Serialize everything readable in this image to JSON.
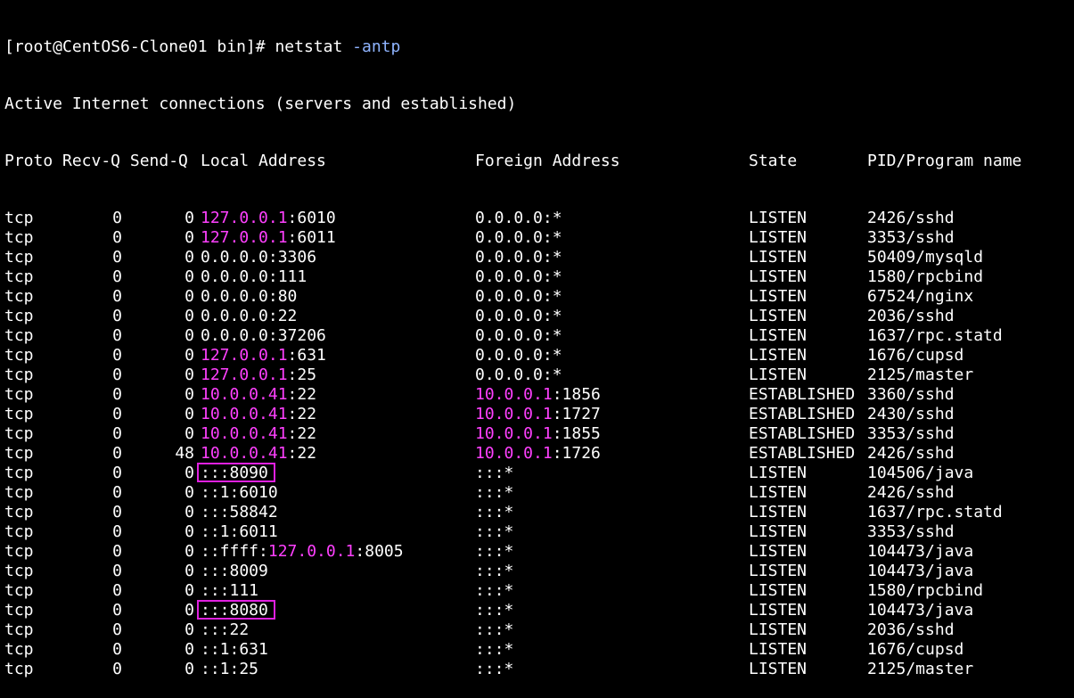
{
  "prompt": {
    "text": "[root@CentOS6-Clone01 bin]# ",
    "command": "netstat",
    "option": "-antp"
  },
  "header_line": "Active Internet connections (servers and established)",
  "columns": {
    "proto": "Proto",
    "recv_send": "Recv-Q Send-Q",
    "local": "Local Address",
    "foreign": "Foreign Address",
    "state": "State",
    "pid": "PID/Program name"
  },
  "highlight_color": "#e020e0",
  "ip_color": "#ff40ff",
  "rows": [
    {
      "proto": "tcp",
      "recv": "0",
      "send": "0",
      "local": [
        {
          "t": "127.0.0.1",
          "ip": true
        },
        {
          "t": ":6010"
        }
      ],
      "foreign": [
        {
          "t": "0.0.0.0:*"
        }
      ],
      "state": "LISTEN",
      "pid": "2426/sshd"
    },
    {
      "proto": "tcp",
      "recv": "0",
      "send": "0",
      "local": [
        {
          "t": "127.0.0.1",
          "ip": true
        },
        {
          "t": ":6011"
        }
      ],
      "foreign": [
        {
          "t": "0.0.0.0:*"
        }
      ],
      "state": "LISTEN",
      "pid": "3353/sshd"
    },
    {
      "proto": "tcp",
      "recv": "0",
      "send": "0",
      "local": [
        {
          "t": "0.0.0.0:3306"
        }
      ],
      "foreign": [
        {
          "t": "0.0.0.0:*"
        }
      ],
      "state": "LISTEN",
      "pid": "50409/mysqld"
    },
    {
      "proto": "tcp",
      "recv": "0",
      "send": "0",
      "local": [
        {
          "t": "0.0.0.0:111"
        }
      ],
      "foreign": [
        {
          "t": "0.0.0.0:*"
        }
      ],
      "state": "LISTEN",
      "pid": "1580/rpcbind"
    },
    {
      "proto": "tcp",
      "recv": "0",
      "send": "0",
      "local": [
        {
          "t": "0.0.0.0:80"
        }
      ],
      "foreign": [
        {
          "t": "0.0.0.0:*"
        }
      ],
      "state": "LISTEN",
      "pid": "67524/nginx"
    },
    {
      "proto": "tcp",
      "recv": "0",
      "send": "0",
      "local": [
        {
          "t": "0.0.0.0:22"
        }
      ],
      "foreign": [
        {
          "t": "0.0.0.0:*"
        }
      ],
      "state": "LISTEN",
      "pid": "2036/sshd"
    },
    {
      "proto": "tcp",
      "recv": "0",
      "send": "0",
      "local": [
        {
          "t": "0.0.0.0:37206"
        }
      ],
      "foreign": [
        {
          "t": "0.0.0.0:*"
        }
      ],
      "state": "LISTEN",
      "pid": "1637/rpc.statd"
    },
    {
      "proto": "tcp",
      "recv": "0",
      "send": "0",
      "local": [
        {
          "t": "127.0.0.1",
          "ip": true
        },
        {
          "t": ":631"
        }
      ],
      "foreign": [
        {
          "t": "0.0.0.0:*"
        }
      ],
      "state": "LISTEN",
      "pid": "1676/cupsd"
    },
    {
      "proto": "tcp",
      "recv": "0",
      "send": "0",
      "local": [
        {
          "t": "127.0.0.1",
          "ip": true
        },
        {
          "t": ":25"
        }
      ],
      "foreign": [
        {
          "t": "0.0.0.0:*"
        }
      ],
      "state": "LISTEN",
      "pid": "2125/master"
    },
    {
      "proto": "tcp",
      "recv": "0",
      "send": "0",
      "local": [
        {
          "t": "10.0.0.41",
          "ip": true
        },
        {
          "t": ":22"
        }
      ],
      "foreign": [
        {
          "t": "10.0.0.1",
          "ip": true
        },
        {
          "t": ":1856"
        }
      ],
      "state": "ESTABLISHED",
      "pid": "3360/sshd"
    },
    {
      "proto": "tcp",
      "recv": "0",
      "send": "0",
      "local": [
        {
          "t": "10.0.0.41",
          "ip": true
        },
        {
          "t": ":22"
        }
      ],
      "foreign": [
        {
          "t": "10.0.0.1",
          "ip": true
        },
        {
          "t": ":1727"
        }
      ],
      "state": "ESTABLISHED",
      "pid": "2430/sshd"
    },
    {
      "proto": "tcp",
      "recv": "0",
      "send": "0",
      "local": [
        {
          "t": "10.0.0.41",
          "ip": true
        },
        {
          "t": ":22"
        }
      ],
      "foreign": [
        {
          "t": "10.0.0.1",
          "ip": true
        },
        {
          "t": ":1855"
        }
      ],
      "state": "ESTABLISHED",
      "pid": "3353/sshd"
    },
    {
      "proto": "tcp",
      "recv": "0",
      "send": "48",
      "local": [
        {
          "t": "10.0.0.41",
          "ip": true
        },
        {
          "t": ":22"
        }
      ],
      "foreign": [
        {
          "t": "10.0.0.1",
          "ip": true
        },
        {
          "t": ":1726"
        }
      ],
      "state": "ESTABLISHED",
      "pid": "2426/sshd"
    },
    {
      "proto": "tcp",
      "recv": "0",
      "send": "0",
      "local": [
        {
          "t": ":::8090"
        }
      ],
      "foreign": [
        {
          "t": ":::*"
        }
      ],
      "state": "LISTEN",
      "pid": "104506/java",
      "highlight": true
    },
    {
      "proto": "tcp",
      "recv": "0",
      "send": "0",
      "local": [
        {
          "t": "::1:6010"
        }
      ],
      "foreign": [
        {
          "t": ":::*"
        }
      ],
      "state": "LISTEN",
      "pid": "2426/sshd"
    },
    {
      "proto": "tcp",
      "recv": "0",
      "send": "0",
      "local": [
        {
          "t": ":::58842"
        }
      ],
      "foreign": [
        {
          "t": ":::*"
        }
      ],
      "state": "LISTEN",
      "pid": "1637/rpc.statd"
    },
    {
      "proto": "tcp",
      "recv": "0",
      "send": "0",
      "local": [
        {
          "t": "::1:6011"
        }
      ],
      "foreign": [
        {
          "t": ":::*"
        }
      ],
      "state": "LISTEN",
      "pid": "3353/sshd"
    },
    {
      "proto": "tcp",
      "recv": "0",
      "send": "0",
      "local": [
        {
          "t": "::ffff:"
        },
        {
          "t": "127.0.0.1",
          "ip": true
        },
        {
          "t": ":8005"
        }
      ],
      "foreign": [
        {
          "t": ":::*"
        }
      ],
      "state": "LISTEN",
      "pid": "104473/java"
    },
    {
      "proto": "tcp",
      "recv": "0",
      "send": "0",
      "local": [
        {
          "t": ":::8009"
        }
      ],
      "foreign": [
        {
          "t": ":::*"
        }
      ],
      "state": "LISTEN",
      "pid": "104473/java"
    },
    {
      "proto": "tcp",
      "recv": "0",
      "send": "0",
      "local": [
        {
          "t": ":::111"
        }
      ],
      "foreign": [
        {
          "t": ":::*"
        }
      ],
      "state": "LISTEN",
      "pid": "1580/rpcbind"
    },
    {
      "proto": "tcp",
      "recv": "0",
      "send": "0",
      "local": [
        {
          "t": ":::8080"
        }
      ],
      "foreign": [
        {
          "t": ":::*"
        }
      ],
      "state": "LISTEN",
      "pid": "104473/java",
      "highlight": true
    },
    {
      "proto": "tcp",
      "recv": "0",
      "send": "0",
      "local": [
        {
          "t": ":::22"
        }
      ],
      "foreign": [
        {
          "t": ":::*"
        }
      ],
      "state": "LISTEN",
      "pid": "2036/sshd"
    },
    {
      "proto": "tcp",
      "recv": "0",
      "send": "0",
      "local": [
        {
          "t": "::1:631"
        }
      ],
      "foreign": [
        {
          "t": ":::*"
        }
      ],
      "state": "LISTEN",
      "pid": "1676/cupsd"
    },
    {
      "proto": "tcp",
      "recv": "0",
      "send": "0",
      "local": [
        {
          "t": "::1:25"
        }
      ],
      "foreign": [
        {
          "t": ":::*"
        }
      ],
      "state": "LISTEN",
      "pid": "2125/master"
    }
  ]
}
